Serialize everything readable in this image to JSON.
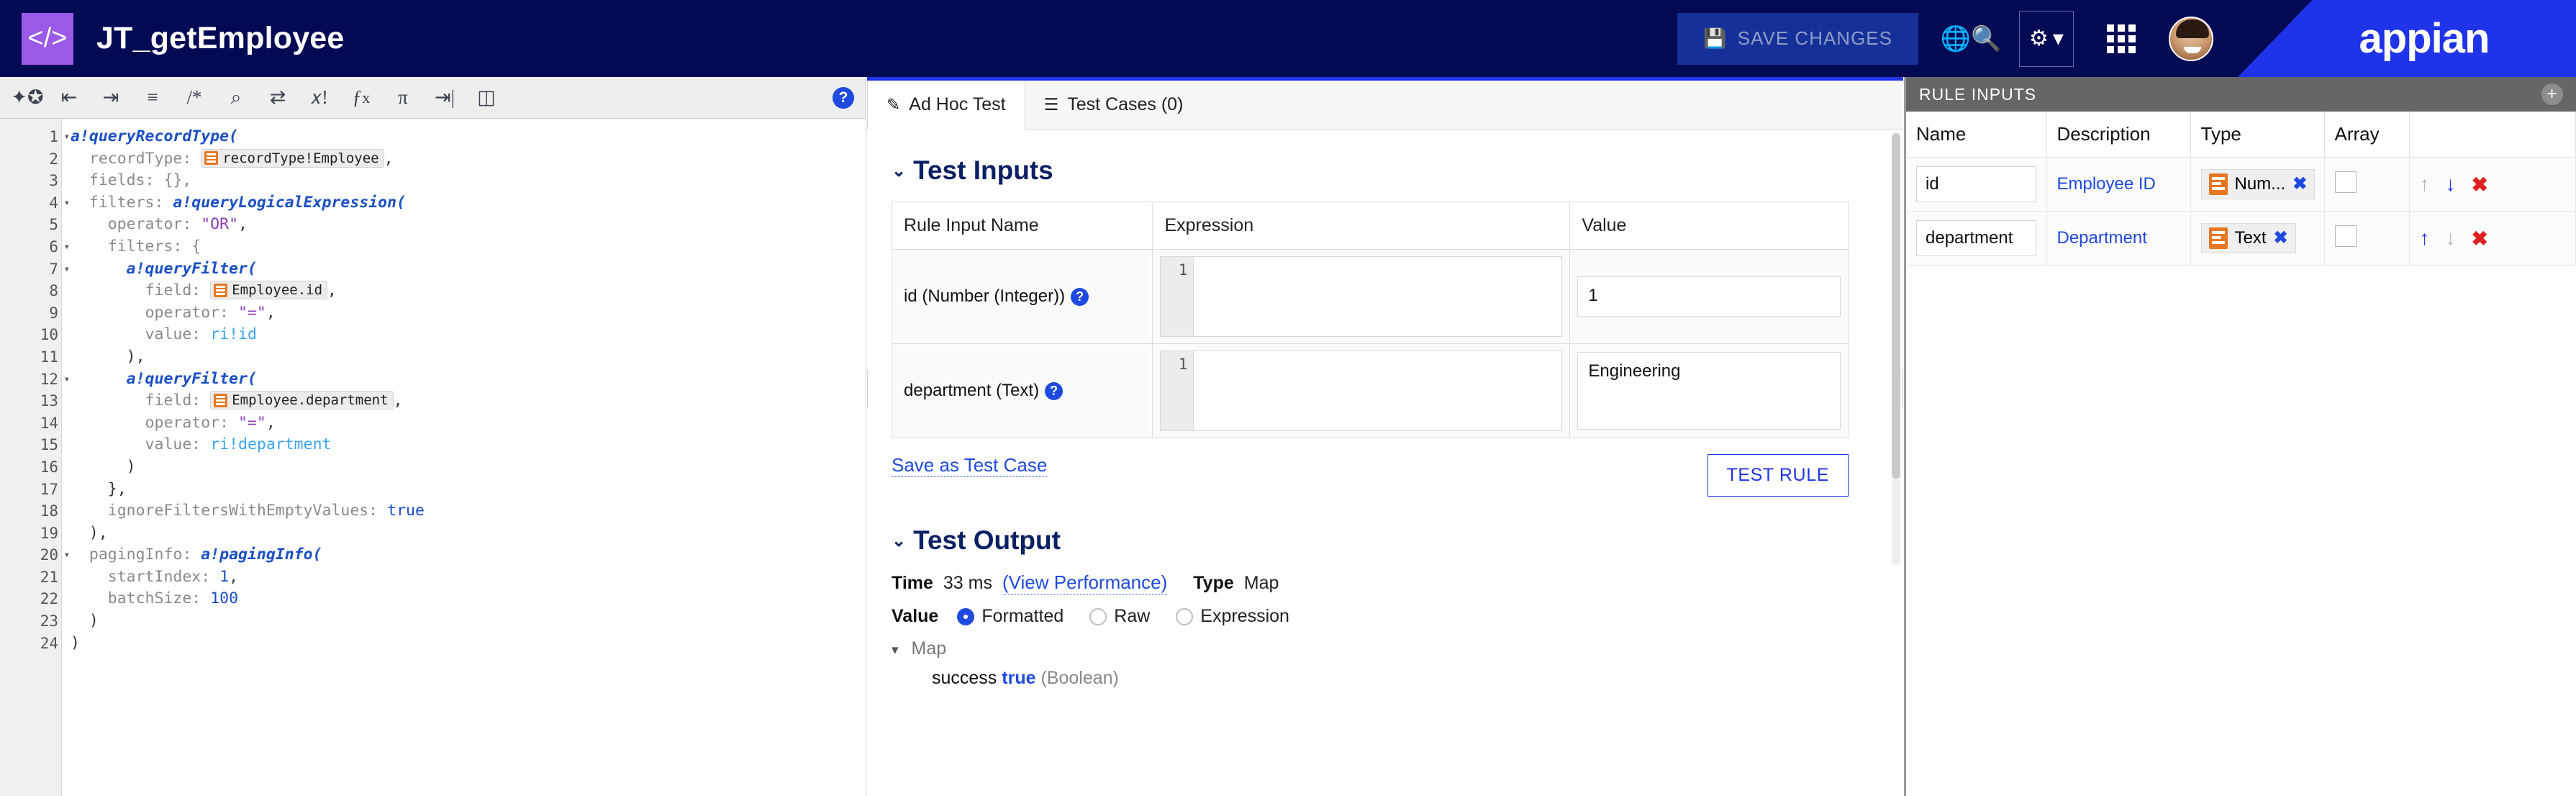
{
  "topbar": {
    "logo_icon": "code-brackets-icon",
    "title": "JT_getEmployee",
    "save_label": "SAVE CHANGES",
    "save_icon": "floppy-disk-icon",
    "search_icon": "globe-search-icon",
    "gear_icon": "gear-icon",
    "gear_caret": "▾",
    "apps_icon": "app-grid-icon",
    "avatar_icon": "user-avatar",
    "brand": "appian"
  },
  "editor": {
    "toolbar": [
      {
        "name": "format-wand-icon",
        "glyph": "✦"
      },
      {
        "name": "outdent-icon",
        "glyph": "⇤"
      },
      {
        "name": "indent-icon",
        "glyph": "⇥"
      },
      {
        "name": "list-icon",
        "glyph": "≡"
      },
      {
        "name": "comment-icon",
        "glyph": "/*"
      },
      {
        "name": "search-icon",
        "glyph": "⌕"
      },
      {
        "name": "shuffle-icon",
        "glyph": "⇄"
      },
      {
        "name": "variable-icon",
        "glyph": "x!"
      },
      {
        "name": "function-icon",
        "glyph": "ƒx"
      },
      {
        "name": "pi-icon",
        "glyph": "π"
      },
      {
        "name": "export-icon",
        "glyph": "⇨"
      },
      {
        "name": "database-search-icon",
        "glyph": "⛁"
      }
    ],
    "help_label": "?",
    "lines": [
      {
        "n": 1,
        "fold": true
      },
      {
        "n": 2,
        "fold": false
      },
      {
        "n": 3,
        "fold": false
      },
      {
        "n": 4,
        "fold": true
      },
      {
        "n": 5,
        "fold": false
      },
      {
        "n": 6,
        "fold": true
      },
      {
        "n": 7,
        "fold": true
      },
      {
        "n": 8,
        "fold": false
      },
      {
        "n": 9,
        "fold": false
      },
      {
        "n": 10,
        "fold": false
      },
      {
        "n": 11,
        "fold": false
      },
      {
        "n": 12,
        "fold": true
      },
      {
        "n": 13,
        "fold": false
      },
      {
        "n": 14,
        "fold": false
      },
      {
        "n": 15,
        "fold": false
      },
      {
        "n": 16,
        "fold": false
      },
      {
        "n": 17,
        "fold": false
      },
      {
        "n": 18,
        "fold": false
      },
      {
        "n": 19,
        "fold": false
      },
      {
        "n": 20,
        "fold": true
      },
      {
        "n": 21,
        "fold": false
      },
      {
        "n": 22,
        "fold": false
      },
      {
        "n": 23,
        "fold": false
      },
      {
        "n": 24,
        "fold": false
      }
    ],
    "code": {
      "l1": "a!queryRecordType(",
      "l2_key": "recordType:",
      "l2_token": "recordType!Employee",
      "l2_tail": ",",
      "l3": "fields: {},",
      "l4_key": "filters:",
      "l4_fn": "a!queryLogicalExpression(",
      "l5_key": "operator:",
      "l5_val": "\"OR\"",
      "l5_tail": ",",
      "l6": "filters: {",
      "l7": "a!queryFilter(",
      "l8_key": "field:",
      "l8_token": "Employee.id",
      "l8_tail": ",",
      "l9_key": "operator:",
      "l9_val": "\"=\"",
      "l9_tail": ",",
      "l10_key": "value:",
      "l10_val": "ri!id",
      "l11": "),",
      "l12": "a!queryFilter(",
      "l13_key": "field:",
      "l13_token": "Employee.department",
      "l13_tail": ",",
      "l14_key": "operator:",
      "l14_val": "\"=\"",
      "l14_tail": ",",
      "l15_key": "value:",
      "l15_val": "ri!department",
      "l16": ")",
      "l17": "},",
      "l18_key": "ignoreFiltersWithEmptyValues:",
      "l18_val": "true",
      "l19": "),",
      "l20_key": "pagingInfo:",
      "l20_fn": "a!pagingInfo(",
      "l21_key": "startIndex:",
      "l21_val": "1",
      "l21_tail": ",",
      "l22_key": "batchSize:",
      "l22_val": "100",
      "l23": ")",
      "l24": ")"
    }
  },
  "middle": {
    "tabs": [
      {
        "label": "Ad Hoc Test",
        "icon": "pencil-square-icon",
        "glyph": "✎",
        "active": true
      },
      {
        "label": "Test Cases (0)",
        "icon": "list-icon",
        "glyph": "☰",
        "active": false
      }
    ],
    "test_inputs": {
      "heading": "Test Inputs",
      "caret": "⌄",
      "columns": [
        "Rule Input Name",
        "Expression",
        "Value"
      ],
      "rows": [
        {
          "name": "id (Number (Integer))",
          "help": "?",
          "expr_line_no": "1",
          "expr_value": "",
          "value": "1"
        },
        {
          "name": "department (Text)",
          "help": "?",
          "expr_line_no": "1",
          "expr_value": "",
          "value": "Engineering"
        }
      ],
      "save_as_test_case": "Save as Test Case",
      "test_rule_button": "TEST RULE"
    },
    "test_output": {
      "heading": "Test Output",
      "caret": "⌄",
      "time_label": "Time",
      "time_value": "33 ms",
      "view_performance": "(View Performance)",
      "type_label": "Type",
      "type_value": "Map",
      "value_label": "Value",
      "value_modes": [
        {
          "label": "Formatted",
          "selected": true
        },
        {
          "label": "Raw",
          "selected": false
        },
        {
          "label": "Expression",
          "selected": false
        }
      ],
      "tree_root": "Map",
      "tree_root_caret": "▾",
      "tree_rows": [
        {
          "key": "success",
          "value": "true",
          "type": "(Boolean)"
        }
      ]
    }
  },
  "rule_inputs": {
    "panel_title": "RULE INPUTS",
    "add_icon": "plus-circle-icon",
    "columns": [
      "Name",
      "Description",
      "Type",
      "Array",
      ""
    ],
    "rows": [
      {
        "name": "id",
        "description": "Employee ID",
        "type": "Num...",
        "type_icon": "number-type-icon",
        "chip_close": "✖",
        "array_checked": false,
        "up_enabled": false,
        "down_enabled": true,
        "delete": "✖"
      },
      {
        "name": "department",
        "description": "Department",
        "type": "Text",
        "type_icon": "text-type-icon",
        "chip_close": "✖",
        "array_checked": false,
        "up_enabled": true,
        "down_enabled": false,
        "delete": "✖"
      }
    ]
  }
}
